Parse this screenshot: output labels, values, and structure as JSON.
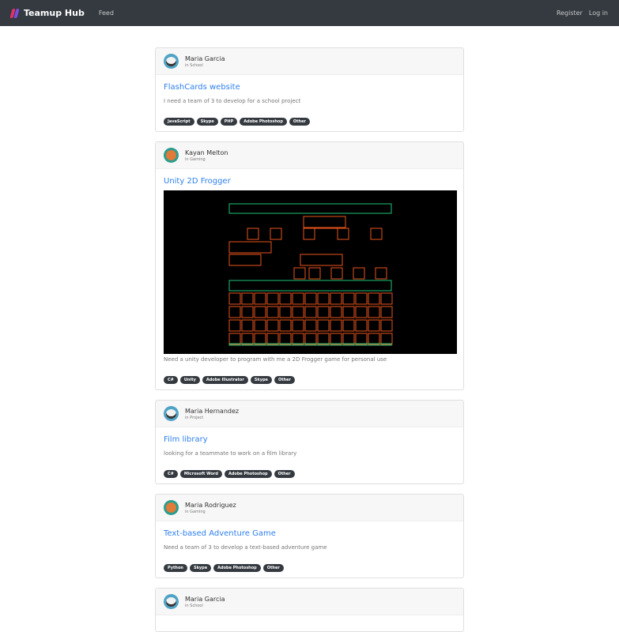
{
  "nav": {
    "brand": "Teamup Hub",
    "feed": "Feed",
    "register": "Register",
    "login": "Log in"
  },
  "posts": [
    {
      "author": "Maria Garcia",
      "category": "in School",
      "avatar": "panda",
      "title": "FlashCards website",
      "description": "I need a team of 3 to develop for a school project",
      "tags": [
        "JavaScript",
        "Skype",
        "PHP",
        "Adobe Photoshop",
        "Other"
      ]
    },
    {
      "author": "Kayan Melton",
      "category": "in Gaming",
      "avatar": "fox",
      "title": "Unity 2D Frogger",
      "description": "Need a unity developer to program with me a 2D Frogger game for personal use",
      "tags": [
        "C#",
        "Unity",
        "Adobe Illustrator",
        "Skype",
        "Other"
      ]
    },
    {
      "author": "Maria Hernandez",
      "category": "in Project",
      "avatar": "panda",
      "title": "Film library",
      "description": "looking for a teammate to work on a film library",
      "tags": [
        "C#",
        "Microsoft Word",
        "Adobe Photoshop",
        "Other"
      ]
    },
    {
      "author": "Maria Rodriguez",
      "category": "in Gaming",
      "avatar": "fox",
      "title": "Text-based Adventure Game",
      "description": "Need a team of 3 to develop a text-based adventure game",
      "tags": [
        "Python",
        "Skype",
        "Adobe Photoshop",
        "Other"
      ]
    },
    {
      "author": "Maria Garcia",
      "category": "in School",
      "avatar": "panda"
    }
  ]
}
